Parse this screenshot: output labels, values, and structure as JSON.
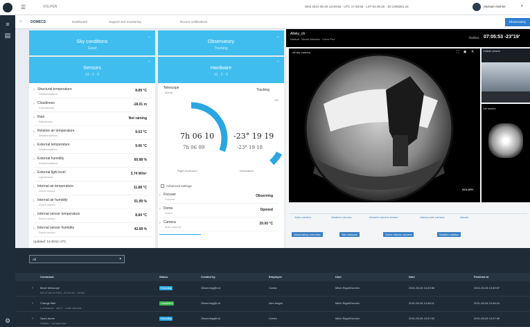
{
  "topbar": {
    "app_name": "VOLPEN",
    "status_text": "Wed 2021-05-26 13:49:56 · UTC 17:49:56 · LST 02:49:16 · JD 2459361.24",
    "user_name": "Michael Abshire",
    "home_label": "Dashboard"
  },
  "subbar": {
    "observatory": "DOMECS",
    "items": [
      "Dashboard",
      "Support and monitoring",
      "Recent notifications"
    ],
    "action_label": "Observatory"
  },
  "tiles": [
    {
      "label": "Sky conditions",
      "sub": "Good",
      "icon": "cloud-icon"
    },
    {
      "label": "Observatory",
      "sub": "Tracking",
      "icon": "dome-icon"
    },
    {
      "label": "Sensors",
      "sub": "13 · 2 · 0",
      "icon": "sensor-icon"
    },
    {
      "label": "Hardware",
      "sub": "11 · 2 · 0",
      "icon": "hardware-icon"
    }
  ],
  "sensors": [
    {
      "name": "Structural temperature",
      "sub": "Weatherstation",
      "value": "8.89 °C"
    },
    {
      "name": "Cloudiness",
      "sub": "Cloudsensor",
      "value": "-18.01 m"
    },
    {
      "name": "Rain",
      "sub": "Rainsensor",
      "value": "Not raining"
    },
    {
      "name": "Relative air temperature",
      "sub": "Weatherstation",
      "value": "9.03 °C"
    },
    {
      "name": "External temperature",
      "sub": "Weatherstation",
      "value": "9.06 °C"
    },
    {
      "name": "External humidity",
      "sub": "Weatherstation",
      "value": "60.98 %"
    },
    {
      "name": "External light level",
      "sub": "Lightsensor",
      "value": "3.74 W/m²"
    },
    {
      "name": "Internal air temperature",
      "sub": "Dome sensor",
      "value": "11.88 °C"
    },
    {
      "name": "Internal air humidity",
      "sub": "Dome sensor",
      "value": "51.99 %"
    },
    {
      "name": "Internal sensor temperature",
      "sub": "Dome sensor",
      "value": "8.84 °C"
    },
    {
      "name": "Internal sensor humidity",
      "sub": "Dome sensor",
      "value": "42.08 %"
    }
  ],
  "sensors_updated": "Updated: 13:49:51 UTC",
  "telescope": {
    "title": "Telescope",
    "sub": "Mount",
    "state": "Tracking",
    "ra": "7h 06 10",
    "ra_sub": "7h 06 09",
    "dec": "-23° 19 19",
    "dec_sub": "-23° 19 18",
    "ra_label": "Right Ascension",
    "dec_label": "Declination",
    "ra_progress": 0.62,
    "dec_progress": 0.35,
    "advanced_label": "Advanced settings",
    "devices": [
      {
        "name": "Focuser",
        "sub": "Focuser",
        "value": "Observing"
      },
      {
        "name": "Dome",
        "sub": "Dome",
        "value": "Opened"
      },
      {
        "name": "Camera",
        "sub": "Main camera",
        "value": "20.00 °C"
      }
    ]
  },
  "camera": {
    "title": "Allsky_cb",
    "subtitle": "Default · Mount Morelos · Cerro Pec",
    "radec_label": "Ra/Dec",
    "radec_value": "07:05:53 -23°19'",
    "feed_label": "All sky camera",
    "side1_label": "Outside camera",
    "side2_label": "Lab camera",
    "watermark": "SOLARY"
  },
  "camera_tabs": [
    "Astro camera",
    "Weather camera",
    "Infrared camera stream",
    "Galaxy web camera",
    "Interior"
  ],
  "camera_buttons": [
    "Observatory overview",
    "Site webcam",
    "Dome interior camera",
    "Weather station"
  ],
  "bottom": {
    "filter_value": "All",
    "columns": [
      "Command",
      "Status",
      "Created by",
      "Employee",
      "User",
      "Date",
      "Finished at"
    ],
    "rows": [
      {
        "command": "Move telescope",
        "detail": "RA 07:06:10 DEC -23:19:19 · J2000",
        "status": "Executing",
        "status_color": "#2aa6e0",
        "created": "Observing@Ltd",
        "employee": "Cortez",
        "user": "Mitch Rigot/Domeio",
        "date": "2021-05-26 13:49:56",
        "finished": "2021-05-26 13:49:57"
      },
      {
        "command": "Change filter",
        "detail": "Luminance · slot 1 · main camera",
        "status": "Completed",
        "status_color": "#3bb54a",
        "created": "Observing@Ltd",
        "employee": "Alex.lenght",
        "user": "Mitch Rigot/Domeio",
        "date": "2021-05-26 13:48:11",
        "finished": "2021-05-26 13:48:14"
      },
      {
        "command": "Open dome",
        "detail": "Shutter · full aperture",
        "status": "Executing",
        "status_color": "#2aa6e0",
        "created": "Observing@Ltd",
        "employee": "Cortez",
        "user": "Mitch Rigot/Domeio",
        "date": "2021-05-26 13:47:02",
        "finished": "2021-05-26 13:47:40"
      }
    ]
  }
}
